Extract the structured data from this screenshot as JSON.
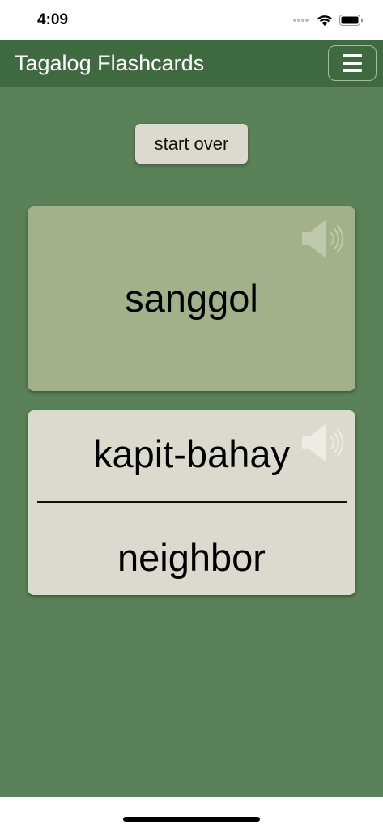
{
  "status_bar": {
    "time": "4:09"
  },
  "nav": {
    "title": "Tagalog Flashcards"
  },
  "controls": {
    "start_over_label": "start over"
  },
  "front_card": {
    "word": "sanggol"
  },
  "back_card": {
    "word": "kapit-bahay",
    "translation": "neighbor"
  },
  "colors": {
    "background": "#5a8158",
    "nav_bar": "#3f6a3f",
    "front_card": "#a3b18a",
    "back_card": "#dcd9cf"
  },
  "icons": [
    "signal-icon",
    "wifi-icon",
    "battery-icon",
    "menu-icon",
    "speaker-icon"
  ]
}
